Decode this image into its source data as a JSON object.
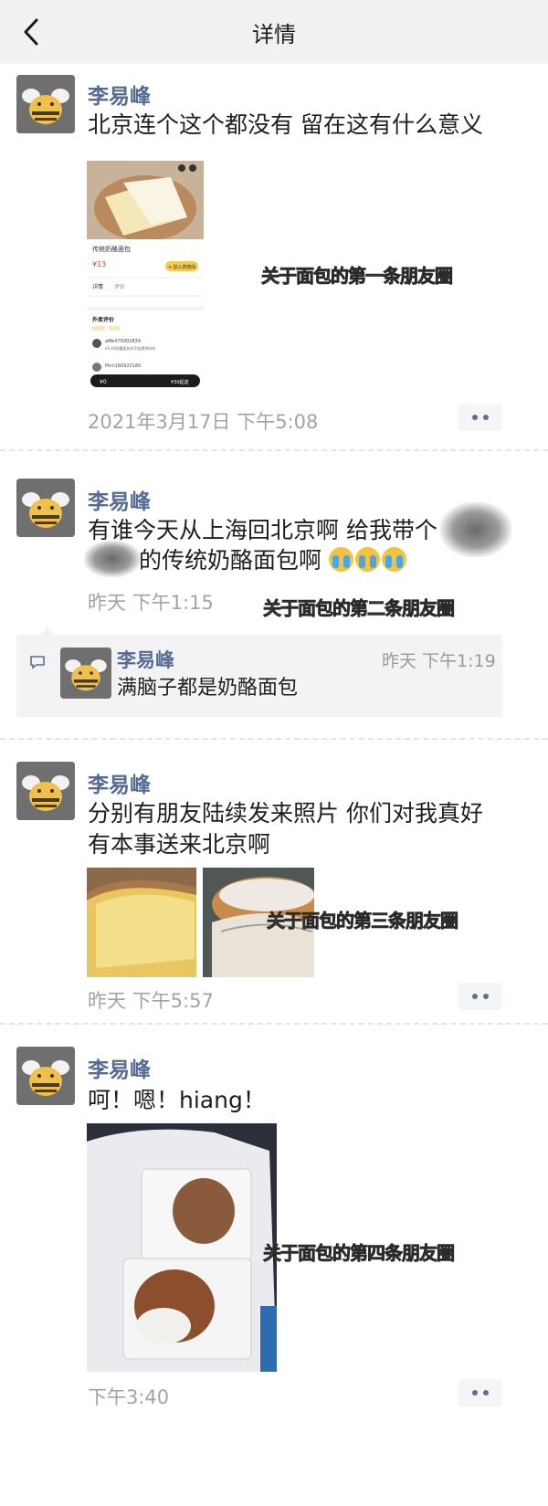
{
  "nav": {
    "title": "详情",
    "back_icon": "chevron-left-icon"
  },
  "author": "李易峰",
  "posts": [
    {
      "text_lines": [
        "北京连个这个都没有  留在这有什么意义"
      ],
      "time": "2021年3月17日 下午5:08",
      "caption": "关于面包的第一条朋友圈"
    },
    {
      "text_lines": [
        "有谁今天从上海回北京啊 给我带个",
        "的传统奶酪面包啊"
      ],
      "emoji": [
        "crying-face-icon",
        "crying-face-icon",
        "crying-face-icon"
      ],
      "time": "昨天  下午1:15",
      "caption": "关于面包的第二条朋友圈"
    },
    {
      "text_lines": [
        "分别有朋友陆续发来照片 你们对我真好",
        "有本事送来北京啊"
      ],
      "time": "昨天  下午5:57",
      "caption": "关于面包的第三条朋友圈"
    },
    {
      "text_lines": [
        "呵！嗯！hiang！"
      ],
      "time": "下午3:40",
      "caption": "关于面包的第四条朋友圈"
    }
  ],
  "comment": {
    "author": "李易峰",
    "time": "昨天  下午1:19",
    "text": "满脑子都是奶酪面包",
    "icon": "comment-icon"
  },
  "shop": {
    "product_name": "传统奶酪面包",
    "price": "¥13",
    "add_button": "+ 加入购物车",
    "tab_details": "详情",
    "tab_reviews": "评价",
    "reviews_title": "外卖评价",
    "user1": "aMk475002839",
    "review1": "e5.40奶酪面包对不起提供好吃",
    "user2": "Pkm160922180",
    "checkout": "¥30起送",
    "cart_price": "¥0"
  },
  "colors": {
    "name": "#566b94",
    "caption": "#f7e12c",
    "time": "#a3a3a3"
  }
}
